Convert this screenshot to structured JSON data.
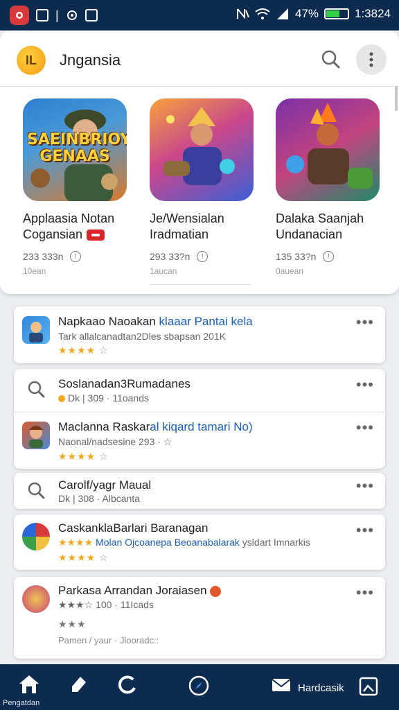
{
  "status": {
    "signal_text": "47%",
    "time": "1:3824",
    "battery_color": "#33cc44"
  },
  "appbar": {
    "title": "Jngansia",
    "logo_text": "IL",
    "logo_icon": "app-logo-icon",
    "search_icon": "search-icon",
    "more_icon": "more-vert-icon"
  },
  "featured": [
    {
      "art_text": "SAEINBRIOY GENAAS",
      "name_line1": "Applaasia Notan",
      "name_line2": "Cogansian",
      "meta": "233 333n",
      "sub": "10ean"
    },
    {
      "art_text": "",
      "name_line1": "Je/Wensialan",
      "name_line2": "Iradmatian",
      "meta": "293 33?n",
      "sub": "1aucan"
    },
    {
      "art_text": "",
      "name_line1": "Dalaka Saanjah",
      "name_line2": "Undanacian",
      "meta": "135 33?n",
      "sub": "0auean"
    }
  ],
  "list": [
    {
      "title": "Napkaao Naoakan ",
      "title_hl": "klaaar Pantai kela",
      "line2": "Tark allalcanadtan2Dles sbapsan 201K",
      "line2_hl": "",
      "stars": "★★★★",
      "stars_empty": "☆",
      "dots": "•••",
      "icon": "game-thumb-icon"
    },
    {
      "title": "Soslanadan3Rumadanes",
      "title_hl": "",
      "line2": "Dk  |  309 · 11oands",
      "line2_hl": "",
      "stars": "",
      "stars_empty": "",
      "dots": "•••",
      "icon": "search-icon"
    },
    {
      "title": "Maclanna Raskar",
      "title_hl": "al kiqard tamari No)",
      "line2": "Naonal/nadsesine 293 · ☆",
      "line2_hl": "",
      "stars": "★★★★",
      "stars_empty": "☆",
      "dots": "•••",
      "icon": "avatar-thumb-icon"
    },
    {
      "title": "Carolf/yagr Maual",
      "title_hl": "",
      "line2": "Dk  |  308 · Albcanta",
      "line2_hl": "",
      "stars": "",
      "stars_empty": "",
      "dots": "•••",
      "icon": "search-icon"
    },
    {
      "title": "CaskanklaBarlari Baranagan",
      "title_hl": "",
      "line2": "★★★★ ",
      "line2_hl": "Molan Ojcoanepa Beoanabalarak",
      "line2_tail": " ysldart Imnarkis",
      "stars": "★★★★",
      "stars_empty": "☆",
      "dots": "•••",
      "icon": "wheel-thumb-icon"
    },
    {
      "title": "Parkasa Arrandan Joraiasen",
      "title_hl": "",
      "line2": "★★★☆ 100 · 11Icads",
      "line2_hl": "",
      "stars": "★★★",
      "stars_empty": "",
      "line4": "Pamen / yaur  ·  Jlooradc::",
      "dots": "•••",
      "icon": "game-thumb-icon"
    }
  ],
  "bottomnav": {
    "home_label": "Pengatdan",
    "messages_label": "Hardcasik"
  }
}
